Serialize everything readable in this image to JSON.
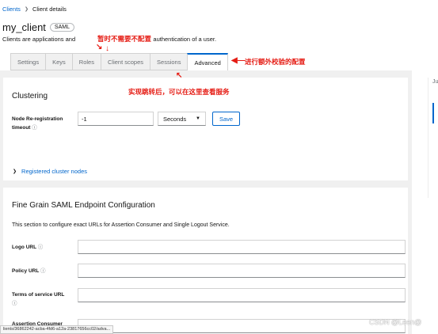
{
  "breadcrumb": {
    "link": "Clients",
    "current": "Client details"
  },
  "header": {
    "title": "my_client",
    "badge": "SAML",
    "subtitle_before": "Clients are applications and ",
    "subtitle_after": "t authentication of a user."
  },
  "tabs": [
    {
      "label": "Settings",
      "active": false
    },
    {
      "label": "Keys",
      "active": false
    },
    {
      "label": "Roles",
      "active": false
    },
    {
      "label": "Client scopes",
      "active": false
    },
    {
      "label": "Sessions",
      "active": false
    },
    {
      "label": "Advanced",
      "active": true
    }
  ],
  "annotations": {
    "top_note": "暂时不需要不配置",
    "tab_note": "进行额外校验的配置",
    "body_note": "实现跳转后，可以在这里查看服务"
  },
  "clustering": {
    "title": "Clustering",
    "node_label_line1": "Node Re-registration",
    "node_label_line2": "timeout",
    "node_value": "-1",
    "unit_select": "Seconds",
    "save_label": "Save",
    "registered_nodes": "Registered cluster nodes"
  },
  "fine_grain": {
    "title": "Fine Grain SAML Endpoint Configuration",
    "description": "This section to configure exact URLs for Assertion Consumer and Single Logout Service.",
    "fields": [
      {
        "label": "Logo URL",
        "value": ""
      },
      {
        "label": "Policy URL",
        "value": ""
      },
      {
        "label": "Terms of service URL",
        "value": ""
      },
      {
        "label": "Assertion Consumer",
        "value": ""
      }
    ]
  },
  "side": {
    "letter": "Ju"
  },
  "status_url": "lients/36862242-acba-4fd6-a12a-23817656cc02/adva...",
  "watermark": "CSDN @Leen@",
  "icons": {
    "help": "help-circle-icon",
    "caret": "caret-down-icon",
    "chevron": "chevron-right-icon",
    "arrow": "red-arrow-icon"
  },
  "colors": {
    "accent": "#0066cc",
    "annotation": "#e51c14",
    "page_bg": "#f0f0f0"
  }
}
